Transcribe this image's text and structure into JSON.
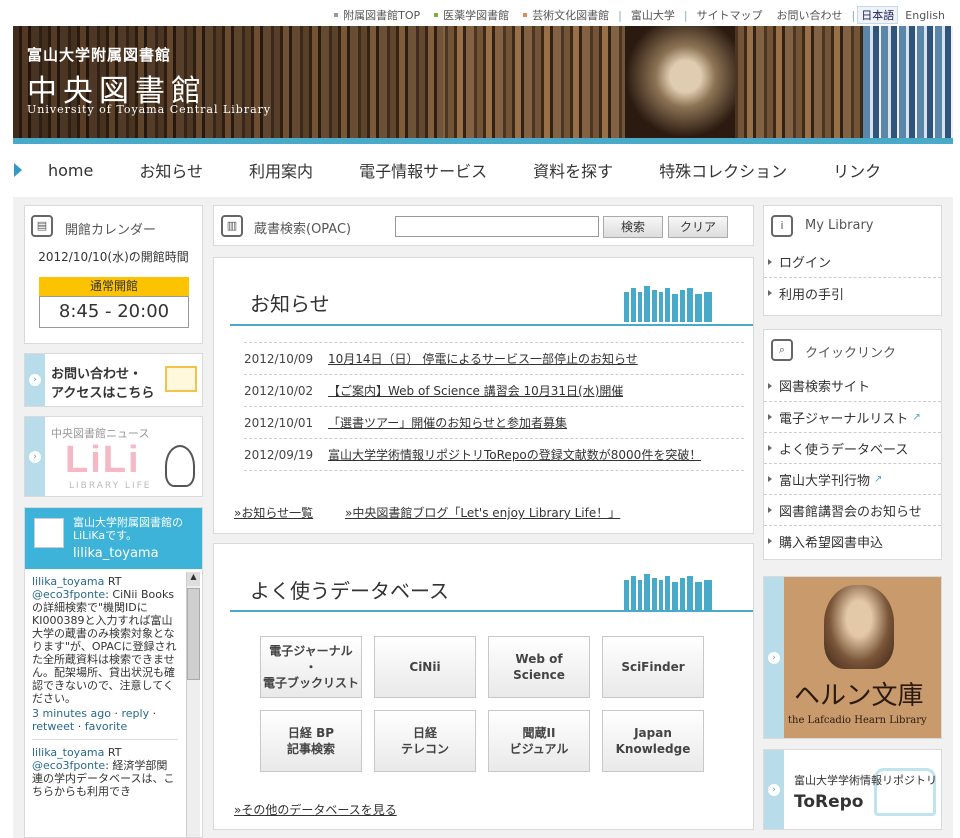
{
  "top_links": [
    {
      "label": "附属図書館TOP",
      "color": "#999999"
    },
    {
      "label": "医薬学図書館",
      "color": "#7fb03a"
    },
    {
      "label": "芸術文化図書館",
      "color": "#e08a5a"
    }
  ],
  "top_links2": [
    "富山大学",
    "サイトマップ",
    "お問い合わせ"
  ],
  "lang": {
    "ja": "日本語",
    "en": "English"
  },
  "banner": {
    "line1": "富山大学附属図書館",
    "line2": "中央図書館",
    "line3": "University of Toyama Central Library"
  },
  "nav": [
    "home",
    "お知らせ",
    "利用案内",
    "電子情報サービス",
    "資料を探す",
    "特殊コレクション",
    "リンク"
  ],
  "calendar": {
    "title": "開館カレンダー",
    "date": "2012/10/10(水)の開館時間",
    "status": "通常開館",
    "hours": "8:45 - 20:00"
  },
  "contact": {
    "line1": "お問い合わせ・",
    "line2": "アクセスはこちら"
  },
  "lili": {
    "small": "中央図書館ニュース",
    "big": "LiLi",
    "sub": "LIBRARY LIFE"
  },
  "twitter": {
    "intro": "富山大学附属図書館のLiLiKaです。",
    "handle": "lilika_toyama",
    "tweets": [
      {
        "user": "lilika_toyama",
        "rt": "RT",
        "mention": "@eco3fponte",
        "text": ": CiNii Books の詳細検索で\"機関IDにKI000389と入力すれば富山大学の蔵書のみ検索対象となります\"が、OPACに登録された全所蔵資料は検索できません。配架場所、貸出状況も確認できないので、注意してください。",
        "time": "3 minutes ago",
        "reply": "reply",
        "retweet": "retweet",
        "favorite": "favorite"
      },
      {
        "user": "lilika_toyama",
        "rt": "RT",
        "mention": "@eco3fponte",
        "text": ": 経済学部関連の学内データベースは、こちらからも利用でき"
      }
    ]
  },
  "opac": {
    "label": "蔵書検索(OPAC)",
    "search": "検索",
    "clear": "クリア",
    "placeholder": ""
  },
  "news": {
    "title": "お知らせ",
    "items": [
      {
        "date": "2012/10/09",
        "text": "10月14日（日） 停電によるサービス一部停止のお知らせ"
      },
      {
        "date": "2012/10/02",
        "text": "【ご案内】Web of Science 講習会 10月31日(水)開催"
      },
      {
        "date": "2012/10/01",
        "text": "「選書ツアー」開催のお知らせと参加者募集"
      },
      {
        "date": "2012/09/19",
        "text": "富山大学学術情報リポジトリToRepoの登録文献数が8000件を突破！"
      }
    ],
    "more1": "»お知らせ一覧",
    "more2": "»中央図書館ブログ「Let's enjoy Library Life！」"
  },
  "db": {
    "title": "よく使うデータベース",
    "items": [
      "電子ジャーナル\n・\n電子ブックリスト",
      "CiNii",
      "Web of\nScience",
      "SciFinder",
      "日経 BP\n記事検索",
      "日経\nテレコン",
      "聞蔵II\nビジュアル",
      "Japan\nKnowledge"
    ],
    "more": "»その他のデータベースを見る"
  },
  "mylibrary": {
    "title": "My Library",
    "items": [
      "ログイン",
      "利用の手引"
    ]
  },
  "quick": {
    "title": "クイックリンク",
    "items": [
      {
        "label": "図書検索サイト",
        "ext": false
      },
      {
        "label": "電子ジャーナルリスト",
        "ext": true
      },
      {
        "label": "よく使うデータベース",
        "ext": false
      },
      {
        "label": "富山大学刊行物",
        "ext": true
      },
      {
        "label": "図書館講習会のお知らせ",
        "ext": false
      },
      {
        "label": "購入希望図書申込",
        "ext": false
      }
    ]
  },
  "hearn": {
    "jp": "ヘルン文庫",
    "en": "the Lafcadio Hearn Library"
  },
  "torepo": {
    "line1": "富山大学学術情報リポジトリ",
    "line2": "ToRepo"
  }
}
